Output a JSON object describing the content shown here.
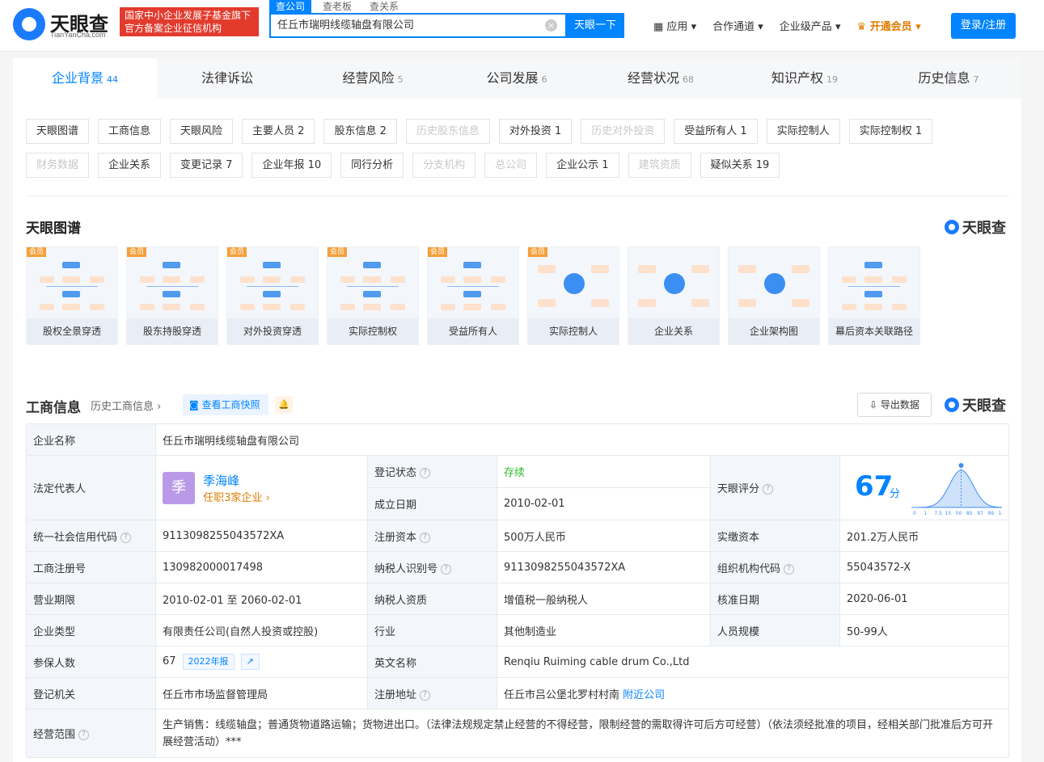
{
  "header": {
    "logo": "天眼查",
    "logo_sub": "TianYanCha.com",
    "promo_line1": "国家中小企业发展子基金旗下",
    "promo_line2": "官方备案企业征信机构",
    "search_tabs": [
      "查公司",
      "查老板",
      "查关系"
    ],
    "search_value": "任丘市瑞明线缆轴盘有限公司",
    "search_button": "天眼一下",
    "nav": [
      "应用",
      "合作通道",
      "企业级产品",
      "开通会员"
    ],
    "login": "登录/注册"
  },
  "tabs": [
    {
      "label": "企业背景",
      "count": "44"
    },
    {
      "label": "法律诉讼",
      "count": ""
    },
    {
      "label": "经营风险",
      "count": "5"
    },
    {
      "label": "公司发展",
      "count": "6"
    },
    {
      "label": "经营状况",
      "count": "68"
    },
    {
      "label": "知识产权",
      "count": "19"
    },
    {
      "label": "历史信息",
      "count": "7"
    }
  ],
  "chips_row1": [
    {
      "t": "天眼图谱",
      "d": false
    },
    {
      "t": "工商信息",
      "d": false
    },
    {
      "t": "天眼风险",
      "d": false
    },
    {
      "t": "主要人员 2",
      "d": false
    },
    {
      "t": "股东信息 2",
      "d": false
    },
    {
      "t": "历史股东信息",
      "d": true
    },
    {
      "t": "对外投资 1",
      "d": false
    },
    {
      "t": "历史对外投资",
      "d": true
    },
    {
      "t": "受益所有人 1",
      "d": false
    },
    {
      "t": "实际控制人",
      "d": false
    },
    {
      "t": "实际控制权 1",
      "d": false
    }
  ],
  "chips_row2": [
    {
      "t": "财务数据",
      "d": true
    },
    {
      "t": "企业关系",
      "d": false
    },
    {
      "t": "变更记录 7",
      "d": false
    },
    {
      "t": "企业年报 10",
      "d": false
    },
    {
      "t": "同行分析",
      "d": false
    },
    {
      "t": "分支机构",
      "d": true
    },
    {
      "t": "总公司",
      "d": true
    },
    {
      "t": "企业公示 1",
      "d": false
    },
    {
      "t": "建筑资质",
      "d": true
    },
    {
      "t": "疑似关系 19",
      "d": false
    }
  ],
  "graph_section": {
    "title": "天眼图谱",
    "brand": "天眼查",
    "badge": "会员",
    "cards": [
      "股权全景穿透",
      "股东持股穿透",
      "对外投资穿透",
      "实际控制权",
      "受益所有人",
      "实际控制人",
      "企业关系",
      "企业架构图",
      "幕后资本关联路径"
    ]
  },
  "biz": {
    "title": "工商信息",
    "history": "历史工商信息 ›",
    "snapshot": "查看工商快照",
    "export": "导出数据",
    "brand": "天眼查"
  },
  "info": {
    "company_name_k": "企业名称",
    "company_name": "任丘市瑞明线缆轴盘有限公司",
    "legal_k": "法定代表人",
    "legal_avatar": "季",
    "legal_name": "季海峰",
    "legal_sub": "任职3家企业 ›",
    "status_k": "登记状态",
    "status": "存续",
    "found_k": "成立日期",
    "found": "2010-02-01",
    "score_k": "天眼评分",
    "score": "67",
    "score_unit": "分",
    "credit_k": "统一社会信用代码",
    "credit": "9113098255043572XA",
    "capital_k": "注册资本",
    "capital": "500万人民币",
    "paid_k": "实缴资本",
    "paid": "201.2万人民币",
    "reg_k": "工商注册号",
    "reg": "130982000017498",
    "tax_k": "纳税人识别号",
    "tax": "9113098255043572XA",
    "org_k": "组织机构代码",
    "org": "55043572-X",
    "term_k": "营业期限",
    "term": "2010-02-01 至 2060-02-01",
    "taxq_k": "纳税人资质",
    "taxq": "增值税一般纳税人",
    "approve_k": "核准日期",
    "approve": "2020-06-01",
    "type_k": "企业类型",
    "type": "有限责任公司(自然人投资或控股)",
    "industry_k": "行业",
    "industry": "其他制造业",
    "staff_k": "人员规模",
    "staff": "50-99人",
    "ins_k": "参保人数",
    "ins": "67",
    "ins_tag": "2022年报",
    "en_k": "英文名称",
    "en": "Renqiu Ruiming cable drum Co.,Ltd",
    "auth_k": "登记机关",
    "auth": "任丘市市场监督管理局",
    "addr_k": "注册地址",
    "addr": "任丘市吕公堡北罗村村南",
    "nearby": "附近公司",
    "scope_k": "经营范围",
    "scope": "生产销售：线缆轴盘；普通货物道路运输；货物进出口。（法律法规规定禁止经营的不得经营，限制经营的需取得许可后方可经营）（依法须经批准的项目，经相关部门批准后方可开展经营活动）***"
  },
  "score_chart": {
    "ticks": [
      "0",
      "1",
      "7.5",
      "15",
      "50",
      "85",
      "97",
      "99",
      "100"
    ],
    "value": 67
  }
}
